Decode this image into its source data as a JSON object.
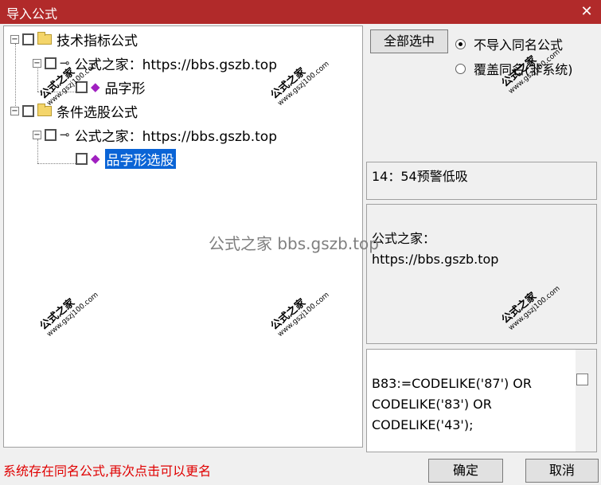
{
  "window": {
    "title": "导入公式",
    "close_icon": "✕"
  },
  "tree": {
    "nodes": [
      {
        "label": "技术指标公式",
        "expander": "−"
      },
      {
        "label": "公式之家：https://bbs.gszb.top",
        "expander": "−"
      },
      {
        "label": "品字形"
      },
      {
        "label": "条件选股公式",
        "expander": "−"
      },
      {
        "label": "公式之家：https://bbs.gszb.top",
        "expander": "−"
      },
      {
        "label": "品字形选股"
      }
    ]
  },
  "right": {
    "select_all_label": "全部选中",
    "radio_no_import": "不导入同名公式",
    "radio_overwrite": "覆盖同名(非系统)",
    "warning_text": "14：54预警低吸",
    "description_text": "公式之家：\nhttps://bbs.gszb.top",
    "code_text": "B83:=CODELIKE('87') OR\nCODELIKE('83') OR\nCODELIKE('43');"
  },
  "footer": {
    "status_text": "系统存在同名公式,再次点击可以更名",
    "ok_label": "确定",
    "cancel_label": "取消"
  },
  "watermark": {
    "center": "公式之家 bbs.gszb.top",
    "stamp": "公式之家",
    "stamp_url": "www.gszj100.com"
  }
}
